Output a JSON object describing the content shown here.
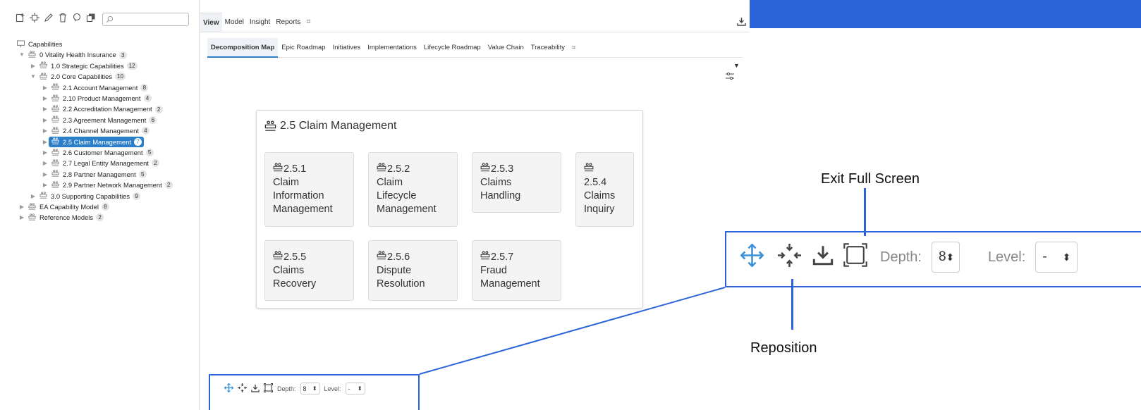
{
  "left_toolbar": {
    "icons": [
      "add-icon",
      "add-node-icon",
      "edit-icon",
      "delete-icon",
      "comment-icon",
      "copy-icon"
    ],
    "search_placeholder": ""
  },
  "tree": {
    "root_label": "Capabilities",
    "items": [
      {
        "label": "0 Vitality Health Insurance",
        "badge": "3"
      },
      {
        "label": "1.0 Strategic Capabilities",
        "badge": "12"
      },
      {
        "label": "2.0 Core Capabilities",
        "badge": "10"
      },
      {
        "label": "2.1 Account Management",
        "badge": "8"
      },
      {
        "label": "2.10 Product Management",
        "badge": "4"
      },
      {
        "label": "2.2 Accreditation Management",
        "badge": "2"
      },
      {
        "label": "2.3 Agreement Management",
        "badge": "6"
      },
      {
        "label": "2.4 Channel Management",
        "badge": "4"
      },
      {
        "label": "2.5 Claim Management",
        "badge": "7"
      },
      {
        "label": "2.6 Customer Management",
        "badge": "5"
      },
      {
        "label": "2.7 Legal Entity Management",
        "badge": "2"
      },
      {
        "label": "2.8 Partner Management",
        "badge": "5"
      },
      {
        "label": "2.9 Partner Network Management",
        "badge": "2"
      },
      {
        "label": "3.0 Supporting Capabilities",
        "badge": "9"
      },
      {
        "label": "EA Capability Model",
        "badge": "8"
      },
      {
        "label": "Reference Models",
        "badge": "2"
      }
    ]
  },
  "main_tabs": [
    "View",
    "Model",
    "Insight",
    "Reports"
  ],
  "sub_tabs": [
    "Decomposition Map",
    "Epic Roadmap",
    "Initiatives",
    "Implementations",
    "Lifecycle Roadmap",
    "Value Chain",
    "Traceability"
  ],
  "map": {
    "title": "2.5 Claim Management",
    "tiles": [
      {
        "num": "2.5.1",
        "name_lines": [
          "Claim",
          "Information",
          "Management"
        ]
      },
      {
        "num": "2.5.2",
        "name_lines": [
          "Claim",
          "Lifecycle",
          "Management"
        ]
      },
      {
        "num": "2.5.3",
        "name_lines": [
          "Claims",
          "Handling"
        ]
      },
      {
        "num": "2.5.4",
        "name_lines": [
          "Claims",
          "Inquiry"
        ]
      },
      {
        "num": "2.5.5",
        "name_lines": [
          "Claims",
          "Recovery"
        ]
      },
      {
        "num": "2.5.6",
        "name_lines": [
          "Dispute",
          "Resolution"
        ]
      },
      {
        "num": "2.5.7",
        "name_lines": [
          "Fraud",
          "Management"
        ]
      }
    ]
  },
  "controls": {
    "depth_label": "Depth:",
    "depth_value": "8",
    "level_label": "Level:",
    "level_value": "-"
  },
  "annotations": {
    "exit_full_screen": "Exit Full Screen",
    "reposition": "Reposition"
  },
  "colors": {
    "accent": "#2b63d9",
    "selected": "#2b7fc9",
    "move_icon": "#3a8fd6"
  }
}
